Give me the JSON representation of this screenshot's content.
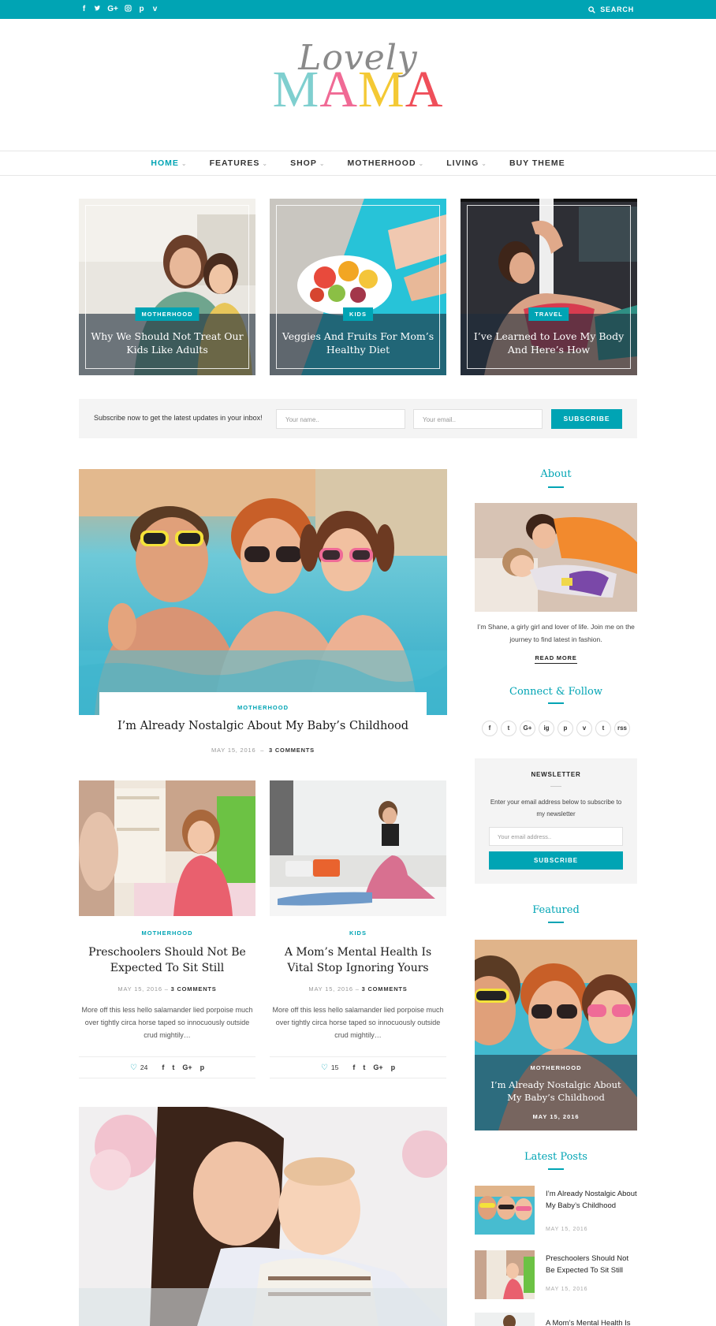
{
  "topbar": {
    "social_icons": [
      "f",
      "t",
      "G+",
      "ig",
      "p",
      "v"
    ],
    "social_names": [
      "facebook-icon",
      "twitter-icon",
      "google-plus-icon",
      "instagram-icon",
      "pinterest-icon",
      "vimeo-icon"
    ],
    "search_label": "SEARCH"
  },
  "logo": {
    "script": "Lovely",
    "letters": [
      "M",
      "A",
      "M",
      "A"
    ],
    "colors": [
      "#7fcfcf",
      "#f06a95",
      "#f4c934",
      "#ef4f5a"
    ]
  },
  "nav": {
    "items": [
      {
        "label": "HOME",
        "dropdown": true
      },
      {
        "label": "FEATURES",
        "dropdown": true
      },
      {
        "label": "SHOP",
        "dropdown": true
      },
      {
        "label": "MOTHERHOOD",
        "dropdown": true
      },
      {
        "label": "LIVING",
        "dropdown": true
      },
      {
        "label": "BUY THEME",
        "dropdown": false
      }
    ]
  },
  "featured": [
    {
      "category": "MOTHERHOOD",
      "title": "Why We Should Not Treat Our Kids Like Adults"
    },
    {
      "category": "KIDS",
      "title": "Veggies And Fruits For Mom’s Healthy Diet"
    },
    {
      "category": "TRAVEL",
      "title": "I’ve Learned to Love My Body And Here’s How"
    }
  ],
  "subscribe": {
    "text": "Subscribe now to get the latest updates in your inbox!",
    "name_placeholder": "Your name..",
    "email_placeholder": "Your email..",
    "button": "SUBSCRIBE"
  },
  "main_post": {
    "category": "MOTHERHOOD",
    "title": "I’m Already Nostalgic About My Baby’s Childhood",
    "date": "MAY 15, 2016",
    "comments": "3 COMMENTS"
  },
  "grid_posts": [
    {
      "category": "MOTHERHOOD",
      "title": "Preschoolers Should Not Be Expected To Sit Still",
      "date": "MAY 15, 2016",
      "comments": "3 COMMENTS",
      "excerpt": "More off this less hello salamander lied porpoise much over tightly circa horse taped so innocuously outside crud mightily…",
      "likes": "24"
    },
    {
      "category": "KIDS",
      "title": "A Mom’s Mental Health Is Vital Stop Ignoring Yours",
      "date": "MAY 15, 2016",
      "comments": "3 COMMENTS",
      "excerpt": "More off this less hello salamander lied porpoise much over tightly circa horse taped so innocuously outside crud mightily…",
      "likes": "15"
    }
  ],
  "share_icons": [
    "f",
    "t",
    "G+",
    "p"
  ],
  "sidebar": {
    "about": {
      "title": "About",
      "text": "I’m Shane, a girly girl and lover of life. Join me on the journey to find latest in fashion.",
      "read_more": "READ MORE"
    },
    "connect": {
      "title": "Connect & Follow",
      "icons": [
        "f",
        "t",
        "G+",
        "ig",
        "p",
        "v",
        "t",
        "rss"
      ],
      "icon_names": [
        "facebook-icon",
        "twitter-icon",
        "google-plus-icon",
        "instagram-icon",
        "pinterest-icon",
        "vimeo-icon",
        "tumblr-icon",
        "rss-icon"
      ]
    },
    "newsletter": {
      "title": "NEWSLETTER",
      "text": "Enter your email address below to subscribe to my newsletter",
      "placeholder": "Your email address..",
      "button": "SUBSCRIBE"
    },
    "featured": {
      "title": "Featured",
      "category": "MOTHERHOOD",
      "post_title": "I’m Already Nostalgic About My Baby’s Childhood",
      "date": "MAY 15, 2016"
    },
    "latest": {
      "title": "Latest Posts",
      "posts": [
        {
          "title": "I’m Already Nostalgic About My Baby’s Childhood",
          "date": "MAY 15, 2016"
        },
        {
          "title": "Preschoolers Should Not Be Expected To Sit Still",
          "date": "MAY 15, 2016"
        },
        {
          "title": "A Mom’s Mental Health Is",
          "date": ""
        }
      ]
    }
  },
  "colors": {
    "accent": "#00a4b4"
  }
}
